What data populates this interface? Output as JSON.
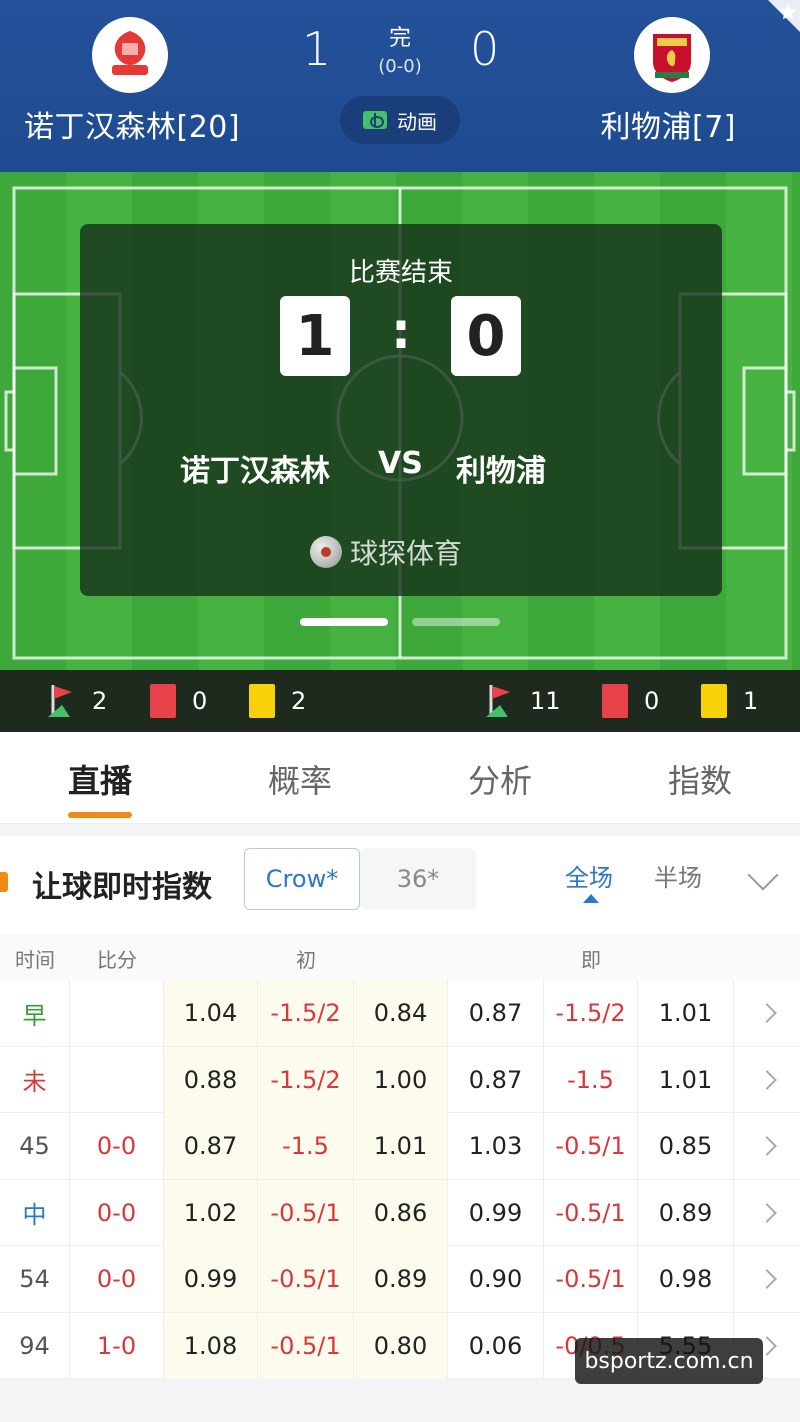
{
  "match": {
    "home_name": "诺丁汉森林[20]",
    "away_name": "利物浦[7]",
    "home_score": "1",
    "away_score": "0",
    "status": "完",
    "half_time": "(0-0)",
    "animation_label": "动画"
  },
  "overlay": {
    "title": "比赛结束",
    "home_digit": "1",
    "away_digit": "0",
    "colon": ":",
    "home_team": "诺丁汉森林",
    "vs": "VS",
    "away_team": "利物浦",
    "brand": "球探体育"
  },
  "stats": {
    "home_corners": "2",
    "home_red": "0",
    "home_yellow": "2",
    "away_corners": "11",
    "away_red": "0",
    "away_yellow": "1"
  },
  "tabs": [
    "直播",
    "概率",
    "分析",
    "指数"
  ],
  "section": {
    "title": "让球即时指数",
    "bookmaker_active": "Crow*",
    "bookmaker_other": "36*",
    "period_active": "全场",
    "period_other": "半场"
  },
  "table": {
    "headers": {
      "time": "时间",
      "score": "比分",
      "initial": "初",
      "live": "即"
    },
    "rows": [
      {
        "time": "早",
        "score": "",
        "o1": "1.04",
        "o2": "-1.5/2",
        "o3": "0.84",
        "o4": "0.87",
        "o5": "-1.5/2",
        "o6": "1.01"
      },
      {
        "time": "未",
        "score": "",
        "o1": "0.88",
        "o2": "-1.5/2",
        "o3": "1.00",
        "o4": "0.87",
        "o5": "-1.5",
        "o6": "1.01"
      },
      {
        "time": "45",
        "score": "0-0",
        "o1": "0.87",
        "o2": "-1.5",
        "o3": "1.01",
        "o4": "1.03",
        "o5": "-0.5/1",
        "o6": "0.85"
      },
      {
        "time": "中",
        "score": "0-0",
        "o1": "1.02",
        "o2": "-0.5/1",
        "o3": "0.86",
        "o4": "0.99",
        "o5": "-0.5/1",
        "o6": "0.89"
      },
      {
        "time": "54",
        "score": "0-0",
        "o1": "0.99",
        "o2": "-0.5/1",
        "o3": "0.89",
        "o4": "0.90",
        "o5": "-0.5/1",
        "o6": "0.98"
      },
      {
        "time": "94",
        "score": "1-0",
        "o1": "1.08",
        "o2": "-0.5/1",
        "o3": "0.80",
        "o4": "0.06",
        "o5": "-0/0.5",
        "o6": "5.55"
      }
    ]
  },
  "watermark": "bsportz.com.cn",
  "colors": {
    "header_blue": "#24529a",
    "accent_orange": "#f08a14",
    "link_blue": "#2b78c5",
    "negative_red": "#d9383a"
  }
}
